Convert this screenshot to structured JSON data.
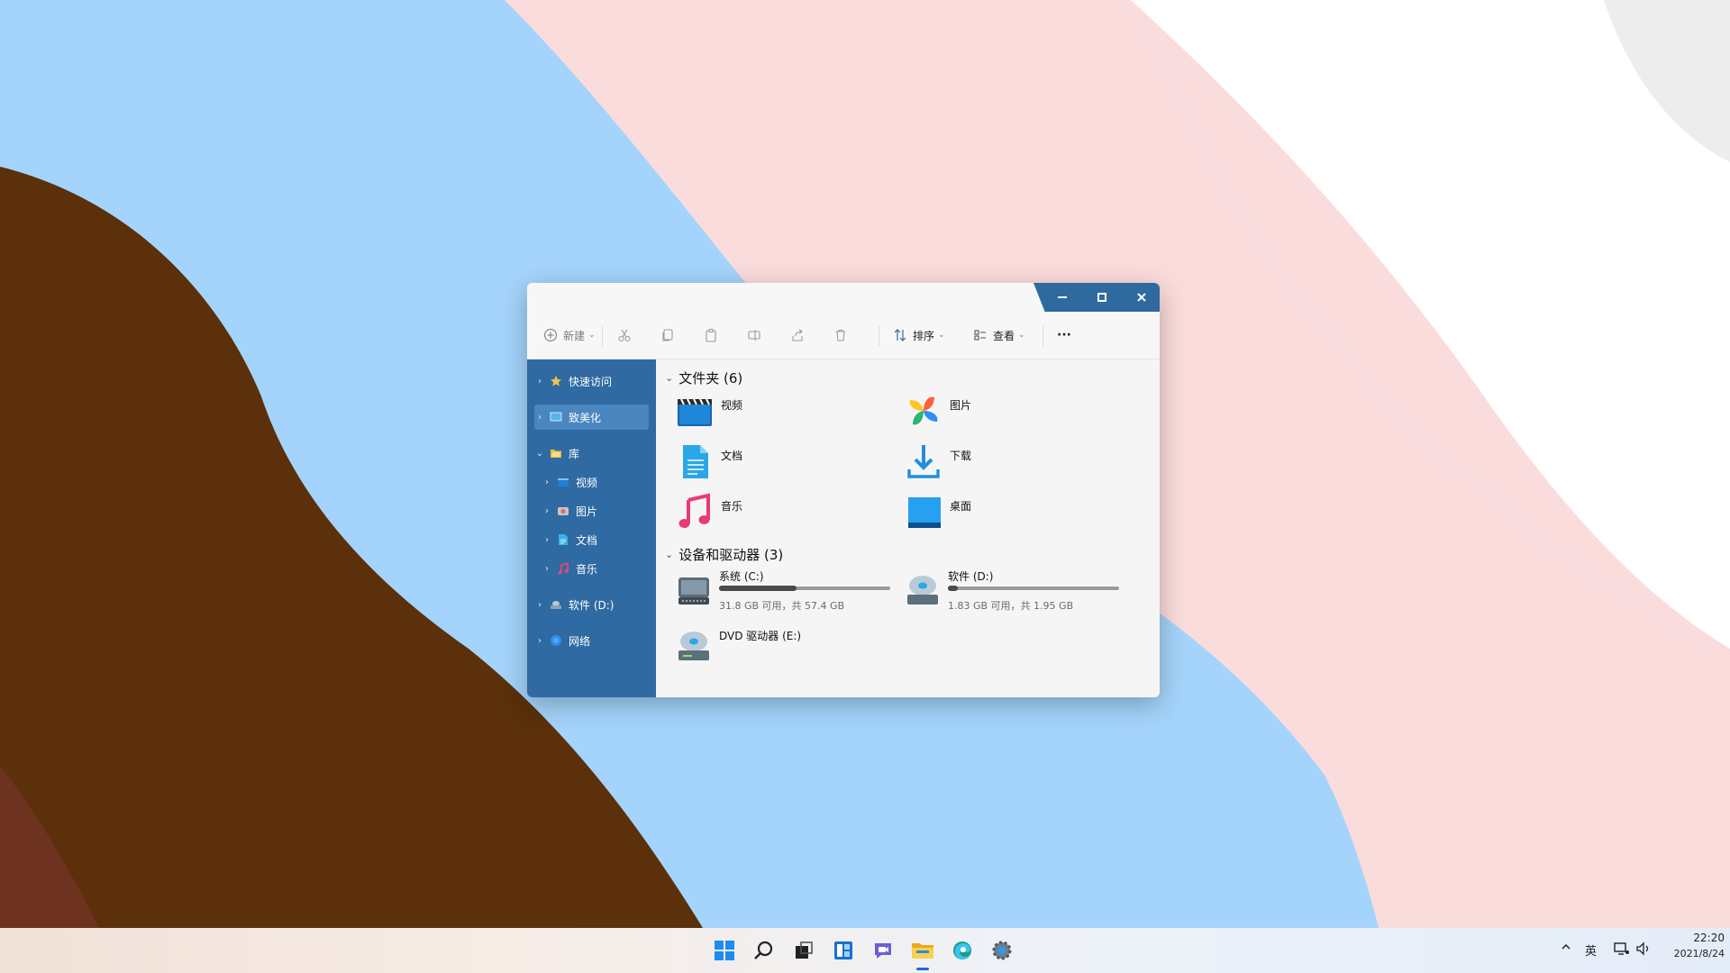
{
  "colors": {
    "accent": "#2f6aa2",
    "wallpaper_blue": "#a4d4fb",
    "wallpaper_pink": "#fbdcdc",
    "wallpaper_brown": "#5b300a",
    "wallpaper_rust": "#6e3220",
    "wallpaper_white": "#ffffff",
    "wallpaper_grey": "#ededed"
  },
  "toolbar": {
    "new_label": "新建",
    "sort_label": "排序",
    "view_label": "查看",
    "more_label": "···"
  },
  "sidebar": {
    "items": [
      {
        "label": "快速访问",
        "icon": "star-icon"
      },
      {
        "label": "致美化",
        "icon": "folder-monitor-icon"
      },
      {
        "label": "库",
        "icon": "library-folder-icon"
      },
      {
        "label": "视频",
        "icon": "video-icon"
      },
      {
        "label": "图片",
        "icon": "picture-icon"
      },
      {
        "label": "文档",
        "icon": "document-icon"
      },
      {
        "label": "音乐",
        "icon": "music-icon"
      },
      {
        "label": "软件 (D:)",
        "icon": "drive-icon"
      },
      {
        "label": "网络",
        "icon": "network-icon"
      }
    ]
  },
  "main": {
    "folders_header": "文件夹 (6)",
    "folders": [
      {
        "label": "视频",
        "icon": "video-folder-icon"
      },
      {
        "label": "图片",
        "icon": "photos-pinwheel-icon"
      },
      {
        "label": "文档",
        "icon": "document-folder-icon"
      },
      {
        "label": "下载",
        "icon": "download-arrow-icon"
      },
      {
        "label": "音乐",
        "icon": "music-note-icon"
      },
      {
        "label": "桌面",
        "icon": "desktop-icon"
      }
    ],
    "drives_header": "设备和驱动器 (3)",
    "drives": [
      {
        "label": "系统 (C:)",
        "free": "31.8 GB 可用，共 57.4 GB",
        "used_fraction": 0.45,
        "icon": "system-drive-icon"
      },
      {
        "label": "软件 (D:)",
        "free": "1.83 GB 可用，共 1.95 GB",
        "used_fraction": 0.06,
        "icon": "disk-drive-icon"
      },
      {
        "label": "DVD 驱动器 (E:)",
        "icon": "dvd-drive-icon"
      }
    ]
  },
  "taskbar": {
    "tray_lang": "英",
    "time": "22:20",
    "date": "2021/8/24",
    "apps": [
      "start-icon",
      "search-icon",
      "task-view-icon",
      "widgets-icon",
      "chat-icon",
      "file-explorer-icon",
      "edge-icon",
      "settings-icon"
    ]
  }
}
